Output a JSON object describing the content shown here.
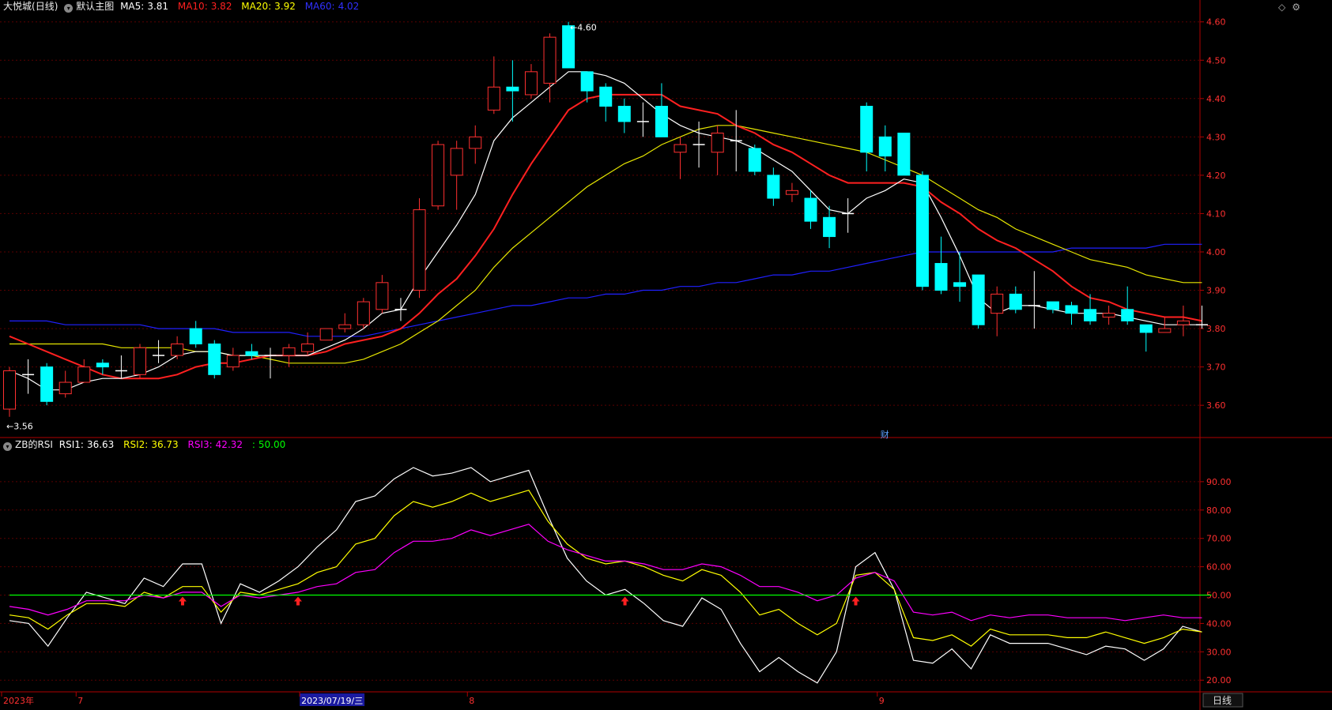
{
  "header": {
    "stock_name": "大悦城",
    "period_label": "(日线)",
    "template_icon": "circle-chevron-down-icon",
    "template_label": "默认主图",
    "ma": [
      {
        "label": "MA5:",
        "value": "3.81",
        "color": "#ffffff"
      },
      {
        "label": "MA10:",
        "value": "3.82",
        "color": "#ff2020"
      },
      {
        "label": "MA20:",
        "value": "3.92",
        "color": "#ffff00"
      },
      {
        "label": "MA60:",
        "value": "4.02",
        "color": "#2020ff"
      }
    ],
    "corner_icons": [
      "diamond-icon",
      "gear-icon"
    ]
  },
  "rsi_header": {
    "icon": "circle-chevron-down-icon",
    "name": "ZB的RSI",
    "items": [
      {
        "label": "RSI1:",
        "value": "36.63",
        "color": "#ffffff"
      },
      {
        "label": "RSI2:",
        "value": "36.73",
        "color": "#ffff00"
      },
      {
        "label": "RSI3:",
        "value": "42.32",
        "color": "#ff00ff"
      },
      {
        "label": ":",
        "value": "50.00",
        "color": "#00ff00"
      }
    ]
  },
  "chart_data": [
    {
      "type": "candlestick",
      "ylim": [
        3.52,
        4.62
      ],
      "yticks": [
        "4.60",
        "4.50",
        "4.40",
        "4.30",
        "4.20",
        "4.10",
        "4.00",
        "3.90",
        "3.80",
        "3.70",
        "3.60"
      ],
      "up_color": "#ff3030",
      "down_color": "#00ffff",
      "doji_color": "#ffffff",
      "candles": [
        [
          3.59,
          3.69,
          3.57,
          3.7
        ],
        [
          3.68,
          3.68,
          3.63,
          3.72
        ],
        [
          3.7,
          3.61,
          3.6,
          3.71
        ],
        [
          3.63,
          3.66,
          3.62,
          3.69
        ],
        [
          3.66,
          3.7,
          3.66,
          3.72
        ],
        [
          3.71,
          3.7,
          3.68,
          3.72
        ],
        [
          3.69,
          3.69,
          3.67,
          3.73
        ],
        [
          3.68,
          3.75,
          3.67,
          3.76
        ],
        [
          3.73,
          3.73,
          3.71,
          3.77
        ],
        [
          3.73,
          3.76,
          3.72,
          3.78
        ],
        [
          3.8,
          3.76,
          3.75,
          3.82
        ],
        [
          3.76,
          3.68,
          3.67,
          3.77
        ],
        [
          3.7,
          3.73,
          3.69,
          3.75
        ],
        [
          3.74,
          3.73,
          3.72,
          3.76
        ],
        [
          3.73,
          3.73,
          3.67,
          3.75
        ],
        [
          3.73,
          3.75,
          3.7,
          3.76
        ],
        [
          3.74,
          3.76,
          3.73,
          3.79
        ],
        [
          3.77,
          3.8,
          3.77,
          3.8
        ],
        [
          3.8,
          3.81,
          3.79,
          3.84
        ],
        [
          3.81,
          3.87,
          3.8,
          3.88
        ],
        [
          3.85,
          3.92,
          3.84,
          3.94
        ],
        [
          3.85,
          3.85,
          3.82,
          3.88
        ],
        [
          3.9,
          4.11,
          3.88,
          4.14
        ],
        [
          4.12,
          4.28,
          4.11,
          4.29
        ],
        [
          4.2,
          4.27,
          4.11,
          4.29
        ],
        [
          4.27,
          4.3,
          4.23,
          4.33
        ],
        [
          4.37,
          4.43,
          4.36,
          4.51
        ],
        [
          4.43,
          4.42,
          4.34,
          4.5
        ],
        [
          4.41,
          4.47,
          4.4,
          4.49
        ],
        [
          4.44,
          4.56,
          4.39,
          4.57
        ],
        [
          4.59,
          4.48,
          4.48,
          4.6
        ],
        [
          4.47,
          4.42,
          4.39,
          4.47
        ],
        [
          4.43,
          4.38,
          4.34,
          4.44
        ],
        [
          4.38,
          4.34,
          4.31,
          4.4
        ],
        [
          4.34,
          4.34,
          4.3,
          4.39
        ],
        [
          4.38,
          4.3,
          4.3,
          4.44
        ],
        [
          4.26,
          4.28,
          4.19,
          4.3
        ],
        [
          4.28,
          4.28,
          4.22,
          4.34
        ],
        [
          4.26,
          4.31,
          4.2,
          4.33
        ],
        [
          4.29,
          4.29,
          4.21,
          4.37
        ],
        [
          4.27,
          4.21,
          4.2,
          4.28
        ],
        [
          4.2,
          4.14,
          4.12,
          4.22
        ],
        [
          4.15,
          4.16,
          4.13,
          4.18
        ],
        [
          4.14,
          4.08,
          4.06,
          4.16
        ],
        [
          4.09,
          4.04,
          4.01,
          4.12
        ],
        [
          4.1,
          4.1,
          4.05,
          4.14
        ],
        [
          4.38,
          4.26,
          4.21,
          4.39
        ],
        [
          4.3,
          4.25,
          4.21,
          4.33
        ],
        [
          4.31,
          4.2,
          4.2,
          4.31
        ],
        [
          4.2,
          3.91,
          3.9,
          4.21
        ],
        [
          3.97,
          3.9,
          3.89,
          4.04
        ],
        [
          3.92,
          3.91,
          3.87,
          4.0
        ],
        [
          3.94,
          3.81,
          3.8,
          3.94
        ],
        [
          3.84,
          3.89,
          3.78,
          3.91
        ],
        [
          3.89,
          3.85,
          3.84,
          3.91
        ],
        [
          3.86,
          3.86,
          3.8,
          3.95
        ],
        [
          3.87,
          3.85,
          3.84,
          3.87
        ],
        [
          3.86,
          3.84,
          3.81,
          3.87
        ],
        [
          3.85,
          3.82,
          3.81,
          3.89
        ],
        [
          3.83,
          3.84,
          3.81,
          3.86
        ],
        [
          3.85,
          3.82,
          3.81,
          3.91
        ],
        [
          3.81,
          3.79,
          3.74,
          3.81
        ],
        [
          3.79,
          3.8,
          3.79,
          3.83
        ],
        [
          3.81,
          3.82,
          3.78,
          3.86
        ],
        [
          3.81,
          3.81,
          3.8,
          3.86
        ]
      ],
      "ma5": [
        3.69,
        3.67,
        3.64,
        3.64,
        3.66,
        3.67,
        3.67,
        3.68,
        3.7,
        3.73,
        3.74,
        3.74,
        3.73,
        3.73,
        3.73,
        3.73,
        3.73,
        3.75,
        3.77,
        3.8,
        3.84,
        3.85,
        3.93,
        4.0,
        4.07,
        4.15,
        4.29,
        4.35,
        4.39,
        4.43,
        4.47,
        4.47,
        4.46,
        4.44,
        4.4,
        4.36,
        4.33,
        4.31,
        4.3,
        4.29,
        4.27,
        4.24,
        4.21,
        4.16,
        4.11,
        4.1,
        4.14,
        4.16,
        4.19,
        4.18,
        4.09,
        3.99,
        3.88,
        3.84,
        3.86,
        3.86,
        3.85,
        3.84,
        3.84,
        3.84,
        3.83,
        3.82,
        3.81,
        3.81,
        3.81
      ],
      "ma10": [
        3.78,
        3.76,
        3.74,
        3.72,
        3.7,
        3.68,
        3.67,
        3.67,
        3.67,
        3.68,
        3.7,
        3.71,
        3.71,
        3.72,
        3.73,
        3.73,
        3.73,
        3.74,
        3.76,
        3.77,
        3.78,
        3.8,
        3.84,
        3.89,
        3.93,
        3.99,
        4.06,
        4.15,
        4.23,
        4.3,
        4.37,
        4.4,
        4.41,
        4.41,
        4.41,
        4.41,
        4.38,
        4.37,
        4.36,
        4.33,
        4.31,
        4.28,
        4.26,
        4.23,
        4.2,
        4.18,
        4.18,
        4.18,
        4.18,
        4.17,
        4.13,
        4.1,
        4.06,
        4.03,
        4.01,
        3.98,
        3.95,
        3.91,
        3.88,
        3.87,
        3.85,
        3.84,
        3.83,
        3.83,
        3.82
      ],
      "ma20": [
        3.76,
        3.76,
        3.76,
        3.76,
        3.76,
        3.76,
        3.75,
        3.75,
        3.75,
        3.75,
        3.74,
        3.74,
        3.73,
        3.73,
        3.72,
        3.71,
        3.71,
        3.71,
        3.71,
        3.72,
        3.74,
        3.76,
        3.79,
        3.82,
        3.86,
        3.9,
        3.96,
        4.01,
        4.05,
        4.09,
        4.13,
        4.17,
        4.2,
        4.23,
        4.25,
        4.28,
        4.3,
        4.32,
        4.33,
        4.33,
        4.32,
        4.31,
        4.3,
        4.29,
        4.28,
        4.27,
        4.26,
        4.24,
        4.22,
        4.2,
        4.17,
        4.14,
        4.11,
        4.09,
        4.06,
        4.04,
        4.02,
        4.0,
        3.98,
        3.97,
        3.96,
        3.94,
        3.93,
        3.92,
        3.92
      ],
      "ma60": [
        3.82,
        3.82,
        3.82,
        3.81,
        3.81,
        3.81,
        3.81,
        3.81,
        3.8,
        3.8,
        3.8,
        3.8,
        3.79,
        3.79,
        3.79,
        3.79,
        3.78,
        3.78,
        3.78,
        3.78,
        3.79,
        3.8,
        3.81,
        3.82,
        3.83,
        3.84,
        3.85,
        3.86,
        3.86,
        3.87,
        3.88,
        3.88,
        3.89,
        3.89,
        3.9,
        3.9,
        3.91,
        3.91,
        3.92,
        3.92,
        3.93,
        3.94,
        3.94,
        3.95,
        3.95,
        3.96,
        3.97,
        3.98,
        3.99,
        4.0,
        4.0,
        4.0,
        4.0,
        4.0,
        4.0,
        4.0,
        4.0,
        4.01,
        4.01,
        4.01,
        4.01,
        4.01,
        4.02,
        4.02,
        4.02
      ],
      "high_label": {
        "index": 30,
        "value": 4.6,
        "text": "4.60"
      },
      "low_label": {
        "index": 0,
        "value": 3.57,
        "text": "3.56"
      },
      "marker": {
        "index": 47,
        "text": "财"
      }
    },
    {
      "type": "line",
      "ylim": [
        17,
        100
      ],
      "yticks": [
        "90.00",
        "80.00",
        "70.00",
        "60.00",
        "50.00",
        "40.00",
        "30.00",
        "20.00"
      ],
      "series": [
        {
          "name": "RSI1",
          "color": "#ffffff",
          "values": [
            41,
            40,
            32,
            42,
            51,
            49,
            47,
            56,
            53,
            61,
            61,
            40,
            54,
            51,
            55,
            60,
            67,
            73,
            83,
            85,
            91,
            95,
            92,
            93,
            95,
            90,
            92,
            94,
            78,
            63,
            55,
            50,
            52,
            47,
            41,
            39,
            49,
            45,
            33,
            23,
            28,
            23,
            19,
            30,
            60,
            65,
            52,
            27,
            26,
            31,
            24,
            36,
            33,
            33,
            33,
            31,
            29,
            32,
            31,
            27,
            31,
            39,
            37
          ]
        },
        {
          "name": "RSI2",
          "color": "#ffff00",
          "values": [
            43,
            42,
            38,
            43,
            47,
            47,
            46,
            51,
            49,
            53,
            53,
            44,
            51,
            50,
            52,
            54,
            58,
            60,
            68,
            70,
            78,
            83,
            81,
            83,
            86,
            83,
            85,
            87,
            76,
            68,
            63,
            61,
            62,
            60,
            57,
            55,
            59,
            57,
            51,
            43,
            45,
            40,
            36,
            40,
            57,
            58,
            52,
            35,
            34,
            36,
            32,
            38,
            36,
            36,
            36,
            35,
            35,
            37,
            35,
            33,
            35,
            38,
            37
          ]
        },
        {
          "name": "RSI3",
          "color": "#ff00ff",
          "values": [
            46,
            45,
            43,
            45,
            48,
            48,
            48,
            50,
            49,
            51,
            51,
            46,
            50,
            49,
            50,
            51,
            53,
            54,
            58,
            59,
            65,
            69,
            69,
            70,
            73,
            71,
            73,
            75,
            69,
            66,
            64,
            62,
            62,
            61,
            59,
            59,
            61,
            60,
            57,
            53,
            53,
            51,
            48,
            50,
            56,
            58,
            55,
            44,
            43,
            44,
            41,
            43,
            42,
            43,
            43,
            42,
            42,
            42,
            41,
            42,
            43,
            42,
            42
          ]
        },
        {
          "name": "",
          "color": "#00ff00",
          "values": [
            50
          ]
        }
      ],
      "arrows": [
        9,
        15,
        32,
        44
      ]
    }
  ],
  "axis_bottom": {
    "labels": [
      {
        "text": "2023年",
        "index": 0,
        "color": "#ff3030"
      },
      {
        "text": "7",
        "index": 4,
        "color": "#ff3030"
      },
      {
        "text": "2023/07/19/三",
        "index": 16,
        "color": "#ffffff",
        "highlight": true
      },
      {
        "text": "8",
        "index": 25,
        "color": "#ff3030"
      },
      {
        "text": "9",
        "index": 47,
        "color": "#ff3030"
      }
    ],
    "period_button": "日线"
  }
}
